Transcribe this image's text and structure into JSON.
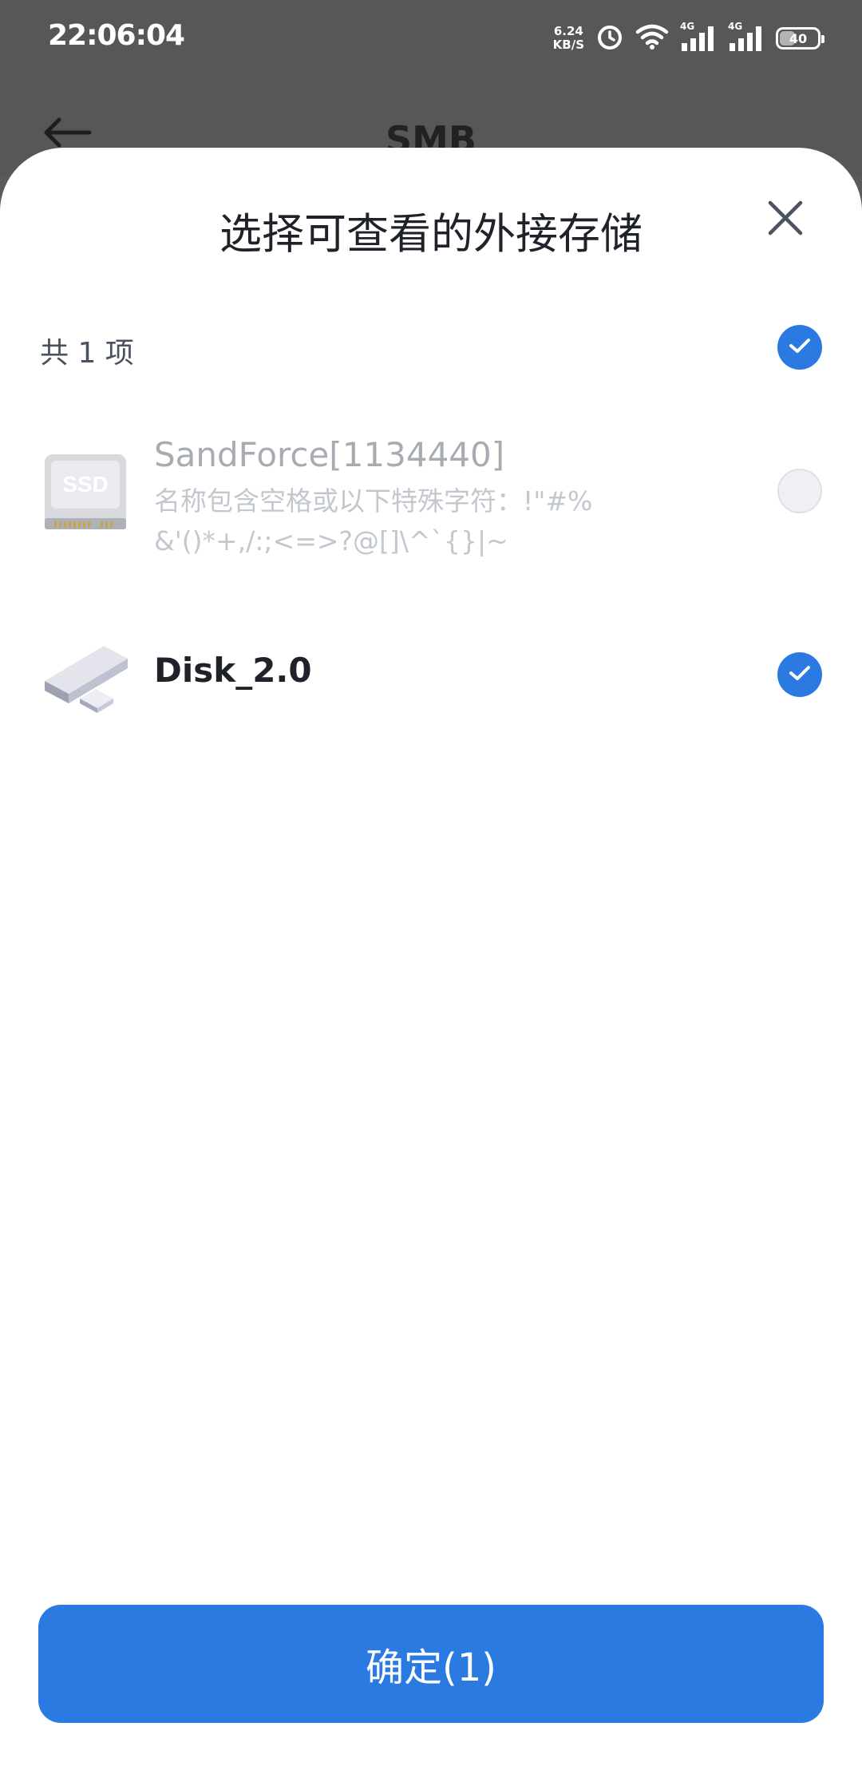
{
  "status_bar": {
    "time": "22:06:04",
    "net_speed_value": "6.24",
    "net_speed_unit": "KB/S",
    "network_type_1": "4G",
    "network_type_2": "4G",
    "battery": "40",
    "battery_level": 0.4,
    "icons": [
      "alarm-icon",
      "wifi-icon",
      "signal-icon",
      "signal-icon",
      "battery-icon"
    ]
  },
  "header": {
    "back_icon": "back-arrow-icon",
    "title": "SMB"
  },
  "sheet": {
    "title": "选择可查看的外接存储",
    "close_icon": "close-icon",
    "count_label": "共 1 项",
    "select_all_checked": true,
    "items": [
      {
        "icon": "ssd-icon",
        "icon_text": "SSD",
        "name": "SandForce[1134440]",
        "description": "名称包含空格或以下特殊字符：!\"#%&'()*+,/:;<=>?@[]\\^`{}|~",
        "checked": false,
        "disabled": true
      },
      {
        "icon": "usb-drive-icon",
        "name": "Disk_2.0",
        "checked": true,
        "disabled": false
      }
    ],
    "confirm_label": "确定(1)"
  },
  "colors": {
    "accent": "#2a7ae2",
    "overlay": "#575757",
    "sheet_bg": "#ffffff"
  }
}
